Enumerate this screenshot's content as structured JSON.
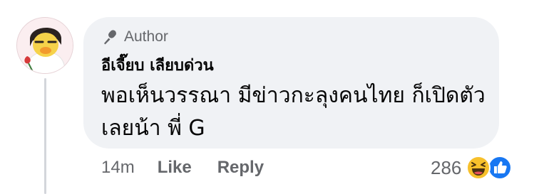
{
  "comment": {
    "author_badge_label": "Author",
    "commenter_name": "อีเจี๊ยบ เลียบด่วน",
    "text": "พอเห็นวรรณา มีข่าวกะลุงคนไทย ก็เปิดตัว เลยน้า พี่ G",
    "timestamp": "14m",
    "like_label": "Like",
    "reply_label": "Reply",
    "reaction_count": "286",
    "reactions": [
      "haha-icon",
      "like-icon"
    ],
    "colors": {
      "bubble": "#f0f2f5",
      "muted_text": "#65676b",
      "primary_text": "#050505",
      "like_blue": "#1877f2",
      "haha_yellow": "#f7c02b"
    }
  }
}
